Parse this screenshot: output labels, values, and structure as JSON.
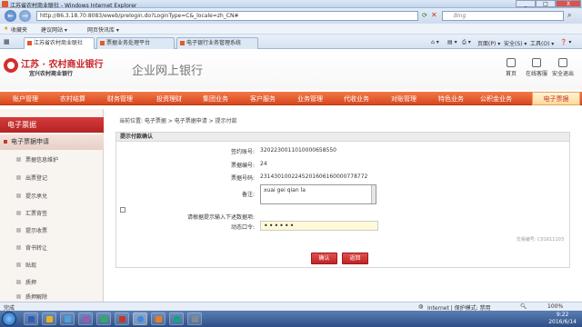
{
  "window": {
    "title": "江苏省农村商业联社 - Windows Internet Explorer",
    "minimize": "_",
    "maximize": "□",
    "close": "X"
  },
  "address": {
    "url": "http://86.3.18.70:8083/eweb/prelogin.do?LoginType=C&_locale=zh_CN#",
    "search_placeholder": "Bing"
  },
  "favorites": {
    "label": "收藏夹",
    "items": [
      "建议网站 ▾",
      "网页快讯库 ▾"
    ]
  },
  "tabs": [
    {
      "label": "江苏省农村商业联社"
    },
    {
      "label": "票据业务处理平台"
    },
    {
      "label": "电子银行业务管理系统"
    }
  ],
  "commands": {
    "page": "页面(P) ▾",
    "safety": "安全(S) ▾",
    "tools": "工具(O) ▾",
    "help": "❓ ▾"
  },
  "header": {
    "bank_name": "江苏 · 农村商业银行",
    "bank_sub": "宜兴农村商业银行",
    "system_title": "企业网上银行",
    "links": [
      "首页",
      "在线客服",
      "安全退出"
    ]
  },
  "nav": {
    "items": [
      "账户管理",
      "农村结算",
      "财务管理",
      "投资理财",
      "集团业务",
      "客户服务",
      "业务管理",
      "代收业务",
      "对账管理",
      "特色业务",
      "公积金业务"
    ],
    "active": "电子票据"
  },
  "sidebar": {
    "title": "电子票据",
    "group": "电子票据申请",
    "items": [
      "票据信息维护",
      "出票登记",
      "提示承兑",
      "汇票背签",
      "提示收票",
      "背书转让",
      "贴现",
      "质押",
      "质押解除"
    ]
  },
  "content": {
    "breadcrumb": "当前位置: 电子票据 > 电子票据申请 > 提示付款",
    "panel_title": "提示付款确认",
    "fields": [
      {
        "label": "签约账号:",
        "value": "3202230011010000658550"
      },
      {
        "label": "票据编号:",
        "value": "24"
      },
      {
        "label": "票据号码:",
        "value": "2314301002245201606160000778772"
      }
    ],
    "note_label": "备注:",
    "note_value": "xuai gei qian la",
    "instruction": "请根据提示输入下述数据项:",
    "password_label": "动态口令:",
    "password_value": "••••••",
    "serial": "交易编号: C01611103",
    "confirm_button": "确认",
    "back_button": "返回"
  },
  "status": {
    "left": "完成",
    "zone": "Internet | 保护模式: 禁用",
    "zoom": "100%"
  },
  "taskbar": {
    "time": "9:22",
    "date": "2016/6/14"
  }
}
